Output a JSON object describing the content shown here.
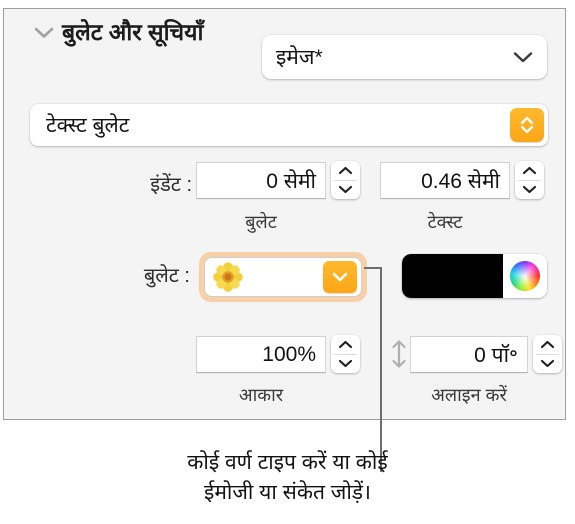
{
  "panel": {
    "section": {
      "title": "बुलेट और सूचियाँ",
      "disclosure_icon": "chevron-down-icon",
      "expanded": true
    },
    "style_popup": {
      "value": "इमेज*",
      "chevron_icon": "chevron-down-icon"
    },
    "bullet_type_combo": {
      "value": "टेक्स्ट बुलेट",
      "stepper_icon": "up-down-chevron-icon",
      "accent_color": "#fba615"
    },
    "indent_row": {
      "label": "इंडेंट :",
      "bullet_indent": {
        "value": "0 सेमी",
        "caption": "बुलेट"
      },
      "text_indent": {
        "value": "0.46 सेमी",
        "caption": "टेक्स्ट"
      }
    },
    "bullet_row": {
      "label": "बुलेट :",
      "bullet_glyph": "flower-emoji",
      "popup_icon": "chevron-down-icon",
      "focused": true,
      "focus_ring_color": "#f7c99a",
      "color_well": {
        "swatch_color": "#000000",
        "wheel_icon": "color-wheel-icon"
      }
    },
    "size_row": {
      "size": {
        "value": "100%",
        "caption": "आकार"
      },
      "align": {
        "value": "0 पॉ॰",
        "caption": "अलाइन करें",
        "icon": "vertical-align-icon"
      }
    }
  },
  "callout": {
    "line1": "कोई वर्ण टाइप करें या कोई",
    "line2": "ईमोजी या संकेत जोड़ें।",
    "leader_color": "#6e6e6e"
  }
}
